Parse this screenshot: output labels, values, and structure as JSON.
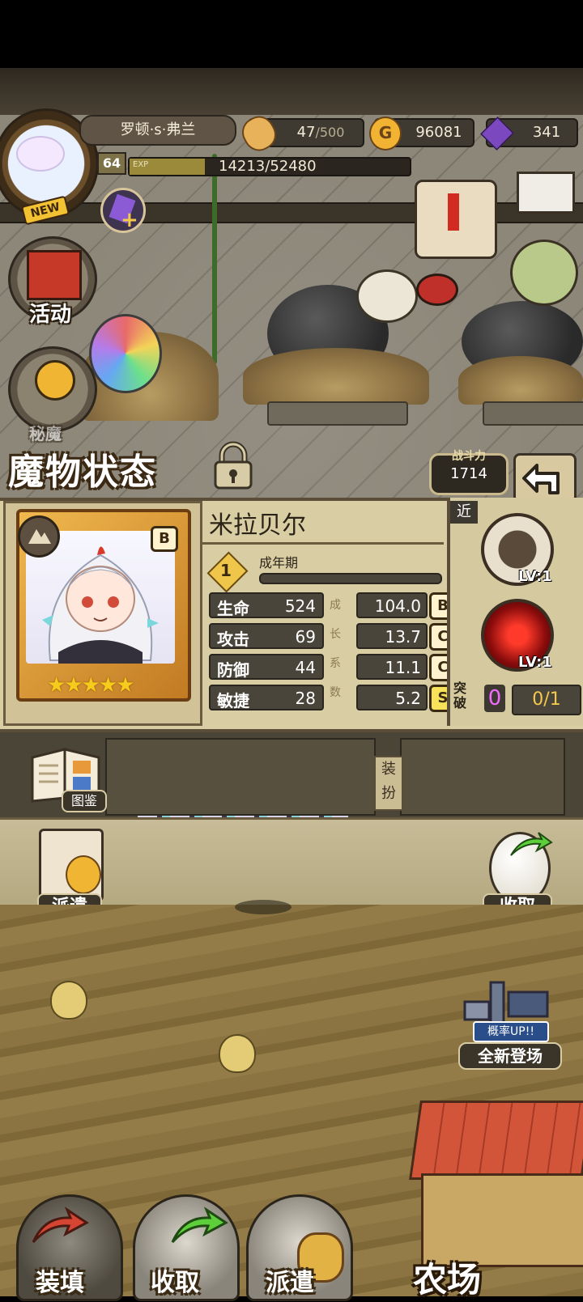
{
  "player": {
    "name": "罗顿·s·弗兰",
    "level": "64",
    "exp_label": "EXP",
    "exp": "14213/52480",
    "exp_fraction": 0.27,
    "new_badge": "NEW"
  },
  "resources": {
    "bread": "47",
    "bread_max": "/500",
    "gold": "96081",
    "gems": "341"
  },
  "menu": {
    "activity": "活动",
    "unknown_partial": "秘魔"
  },
  "status": {
    "title": "魔物状态",
    "power_label": "战斗力",
    "power_value": "1714"
  },
  "monster": {
    "name": "米拉贝尔",
    "grade": "B",
    "stars": 5,
    "stars_text": "★★★★★",
    "stage_number": "1",
    "stage_label": "成年期",
    "stage_progress": 0.0,
    "growth_label": "成长系数",
    "stats": [
      {
        "name": "生命",
        "value": "524",
        "growth": "104.0",
        "grade": "B"
      },
      {
        "name": "攻击",
        "value": "69",
        "growth": "13.7",
        "grade": "C"
      },
      {
        "name": "防御",
        "value": "44",
        "growth": "11.1",
        "grade": "C"
      },
      {
        "name": "敏捷",
        "value": "28",
        "growth": "5.2",
        "grade": "S"
      }
    ]
  },
  "skills": {
    "range_tag": "近",
    "skill1_level": "LV:1",
    "skill2_level": "LV:1",
    "break_label": "突破",
    "break_value": "0",
    "break_progress": "0/1"
  },
  "shelf": {
    "book_label": "图鉴",
    "equip_label": "装扮"
  },
  "actions": {
    "dispatch": "派遣",
    "collect": "收取",
    "banner_sub": "概率UP!!",
    "banner_label": "全新登场"
  },
  "bottom_nav": {
    "load": "装填",
    "collect": "收取",
    "dispatch": "派遣",
    "farm": "农场"
  },
  "colors": {
    "accent_gold": "#f7cb1c",
    "panel": "#d9cda4",
    "break_value": "#f26bff"
  }
}
